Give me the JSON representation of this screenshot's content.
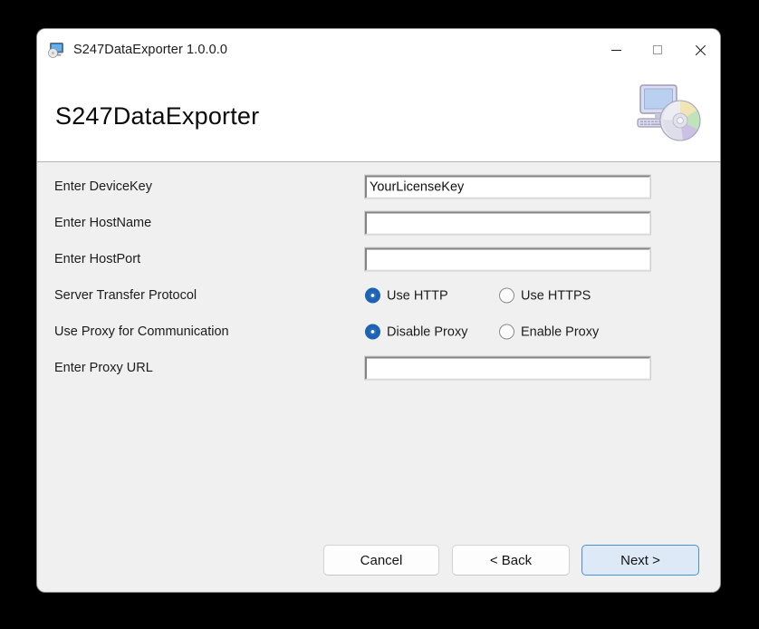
{
  "window": {
    "title": "S247DataExporter 1.0.0.0",
    "icon": "monitor-disc-icon",
    "controls": {
      "minimize": "minimize-icon",
      "maximize": "maximize-icon",
      "close": "close-icon"
    }
  },
  "header": {
    "title": "S247DataExporter",
    "logo": "computer-cd-icon"
  },
  "form": {
    "rows": [
      {
        "label": "Enter DeviceKey",
        "type": "text",
        "value": "YourLicenseKey",
        "placeholder": "",
        "focused": true
      },
      {
        "label": "Enter HostName",
        "type": "text",
        "value": "",
        "placeholder": "",
        "focused": false
      },
      {
        "label": "Enter HostPort",
        "type": "text",
        "value": "",
        "placeholder": "",
        "focused": false
      },
      {
        "label": "Server Transfer Protocol",
        "type": "radio",
        "options": [
          {
            "label": "Use HTTP",
            "selected": true
          },
          {
            "label": "Use HTTPS",
            "selected": false
          }
        ]
      },
      {
        "label": "Use Proxy for Communication",
        "type": "radio",
        "options": [
          {
            "label": "Disable Proxy",
            "selected": true
          },
          {
            "label": "Enable Proxy",
            "selected": false
          }
        ]
      },
      {
        "label": "Enter Proxy URL",
        "type": "text",
        "value": "",
        "placeholder": "",
        "focused": false
      }
    ]
  },
  "footer": {
    "cancel_label": "Cancel",
    "back_label": "< Back",
    "next_label": "Next >"
  },
  "colors": {
    "accent_radio": "#1d62b5",
    "default_button_border": "#4a90d9",
    "default_button_fill": "#dde9f7",
    "body_background": "#f0f0f0",
    "header_background": "#ffffff",
    "desktop_background": "#000000"
  }
}
